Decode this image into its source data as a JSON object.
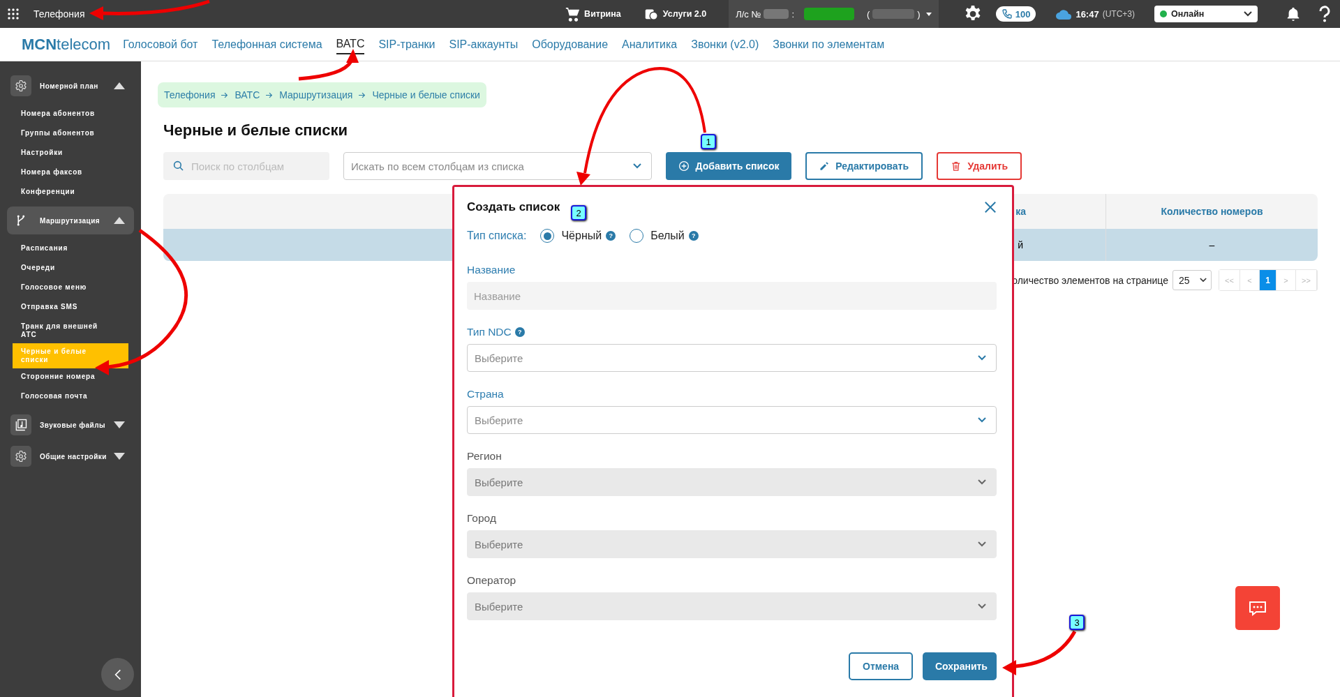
{
  "topbar": {
    "app_title": "Телефония",
    "shop": "Витрина",
    "services": "Услуги 2.0",
    "account": {
      "label": "Л/с №",
      "separator": ":",
      "open": "(",
      "close": ")"
    },
    "calls": "100",
    "time": "16:47",
    "timezone": "(UTC+3)",
    "status": {
      "label": "Онлайн",
      "online": true
    }
  },
  "nav": {
    "logo": {
      "bold": "MCN",
      "rest": "telecom"
    },
    "items": [
      {
        "label": "Голосовой бот",
        "selected": false
      },
      {
        "label": "Телефонная система",
        "selected": false
      },
      {
        "label": "ВАТС",
        "selected": true
      },
      {
        "label": "SIP-транки",
        "selected": false
      },
      {
        "label": "SIP-аккаунты",
        "selected": false
      },
      {
        "label": "Оборудование",
        "selected": false
      },
      {
        "label": "Аналитика",
        "selected": false
      },
      {
        "label": "Звонки (v2.0)",
        "selected": false
      },
      {
        "label": "Звонки по элементам",
        "selected": false
      }
    ]
  },
  "sidebar": {
    "groups": [
      {
        "kind": "gear",
        "label": "Номерной план",
        "expanded": true,
        "active": false,
        "items": [
          {
            "label": "Номера абонентов",
            "selected": false
          },
          {
            "label": "Группы абонентов",
            "selected": false
          },
          {
            "label": "Настройки",
            "selected": false
          },
          {
            "label": "Номера факсов",
            "selected": false
          },
          {
            "label": "Конференции",
            "selected": false
          }
        ]
      },
      {
        "kind": "branch",
        "label": "Маршрутизация",
        "expanded": true,
        "active": true,
        "items": [
          {
            "label": "Расписания",
            "selected": false
          },
          {
            "label": "Очереди",
            "selected": false
          },
          {
            "label": "Голосовое меню",
            "selected": false
          },
          {
            "label": "Отправка SMS",
            "selected": false
          },
          {
            "label": "Транк для внешней АТС",
            "selected": false
          },
          {
            "label": "Черные и белые списки",
            "selected": true
          },
          {
            "label": "Сторонние номера",
            "selected": false
          },
          {
            "label": "Голосовая почта",
            "selected": false
          }
        ]
      },
      {
        "kind": "music",
        "label": "Звуковые файлы",
        "expanded": false,
        "active": false
      },
      {
        "kind": "gear",
        "label": "Общие настройки",
        "expanded": false,
        "active": false
      }
    ]
  },
  "breadcrumb": [
    "Телефония",
    "ВАТС",
    "Маршрутизация",
    "Черные и белые списки"
  ],
  "page_title": "Черные и белые списки",
  "toolbar": {
    "search_placeholder": "Поиск по столбцам",
    "column_select": "Искать по всем столбцам из списка",
    "buttons": [
      {
        "kind": "add",
        "label": "Добавить список"
      },
      {
        "kind": "edit",
        "label": "Редактировать"
      },
      {
        "kind": "delete",
        "label": "Удалить"
      }
    ]
  },
  "table": {
    "columns": [
      "ка",
      "Количество номеров"
    ],
    "rows": [
      {
        "cells": [
          "й",
          "–"
        ],
        "selected": true
      }
    ]
  },
  "pagination": {
    "label": "оличество элементов на странице",
    "page_size": "25",
    "pages": [
      {
        "label": "<<",
        "selected": false
      },
      {
        "label": "<",
        "selected": false
      },
      {
        "label": "1",
        "selected": true
      },
      {
        "label": ">",
        "selected": false
      },
      {
        "label": ">>",
        "selected": false
      }
    ]
  },
  "modal": {
    "title": "Создать список",
    "list_type": {
      "label": "Тип списка:",
      "options": [
        {
          "label": "Чёрный",
          "selected": true,
          "help": "?"
        },
        {
          "label": "Белый",
          "selected": false,
          "help": "?"
        }
      ]
    },
    "fields": [
      {
        "kind": "text",
        "label": "Название",
        "placeholder": "Название",
        "disabled": false
      },
      {
        "kind": "select",
        "label": "Тип NDC",
        "help": "?",
        "value": "Выберите",
        "disabled": false
      },
      {
        "kind": "select",
        "label": "Страна",
        "value": "Выберите",
        "disabled": false
      },
      {
        "kind": "select",
        "label": "Регион",
        "value": "Выберите",
        "disabled": true
      },
      {
        "kind": "select",
        "label": "Город",
        "value": "Выберите",
        "disabled": true
      },
      {
        "kind": "select",
        "label": "Оператор",
        "value": "Выберите",
        "disabled": true
      }
    ],
    "buttons": [
      {
        "kind": "secondary",
        "label": "Отмена"
      },
      {
        "kind": "primary",
        "label": "Сохранить"
      }
    ]
  },
  "annotations": [
    "1",
    "2",
    "3"
  ]
}
